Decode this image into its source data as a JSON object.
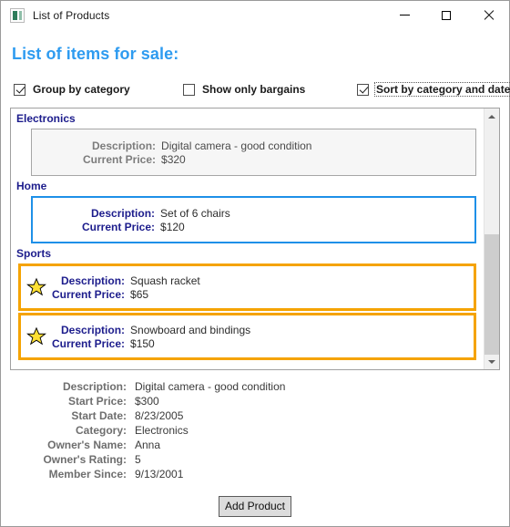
{
  "window": {
    "title": "List of Products",
    "icon": "app-icon",
    "controls": {
      "minimize": "minimize-icon",
      "maximize": "maximize-icon",
      "close": "close-icon"
    }
  },
  "heading": "List of items for sale:",
  "options": [
    {
      "label": "Group by category",
      "checked": true,
      "focused": false
    },
    {
      "label": "Show only bargains",
      "checked": false,
      "focused": false
    },
    {
      "label": "Sort by category and date",
      "checked": true,
      "focused": true
    }
  ],
  "list": {
    "field_labels": {
      "description": "Description:",
      "current_price": "Current Price:"
    },
    "groups": [
      {
        "name": "Electronics",
        "items": [
          {
            "description": "Digital camera - good condition",
            "current_price": "$320",
            "state": "disabled",
            "bargain": false
          }
        ]
      },
      {
        "name": "Home",
        "items": [
          {
            "description": "Set of 6 chairs",
            "current_price": "$120",
            "state": "selected",
            "bargain": false
          }
        ]
      },
      {
        "name": "Sports",
        "items": [
          {
            "description": "Squash racket",
            "current_price": "$65",
            "state": "bargain",
            "bargain": true
          },
          {
            "description": "Snowboard and bindings",
            "current_price": "$150",
            "state": "bargain",
            "bargain": true
          }
        ]
      }
    ],
    "scrollbar": {
      "up_icon": "scroll-up-icon",
      "down_icon": "scroll-down-icon"
    }
  },
  "details": {
    "rows": [
      {
        "label": "Description:",
        "value": "Digital camera - good condition"
      },
      {
        "label": "Start Price:",
        "value": "$300"
      },
      {
        "label": "Start Date:",
        "value": "8/23/2005"
      },
      {
        "label": "Category:",
        "value": "Electronics"
      },
      {
        "label": "Owner's Name:",
        "value": "Anna"
      },
      {
        "label": "Owner's Rating:",
        "value": "5"
      },
      {
        "label": "Member Since:",
        "value": "9/13/2001"
      }
    ]
  },
  "add_button": "Add Product",
  "colors": {
    "heading": "#2e9bf0",
    "group_header": "#1c1c8c",
    "selected_border": "#1e90e8",
    "bargain_border": "#f5a300",
    "star_fill": "#ffe033",
    "disabled_text": "#7c7c7c"
  }
}
